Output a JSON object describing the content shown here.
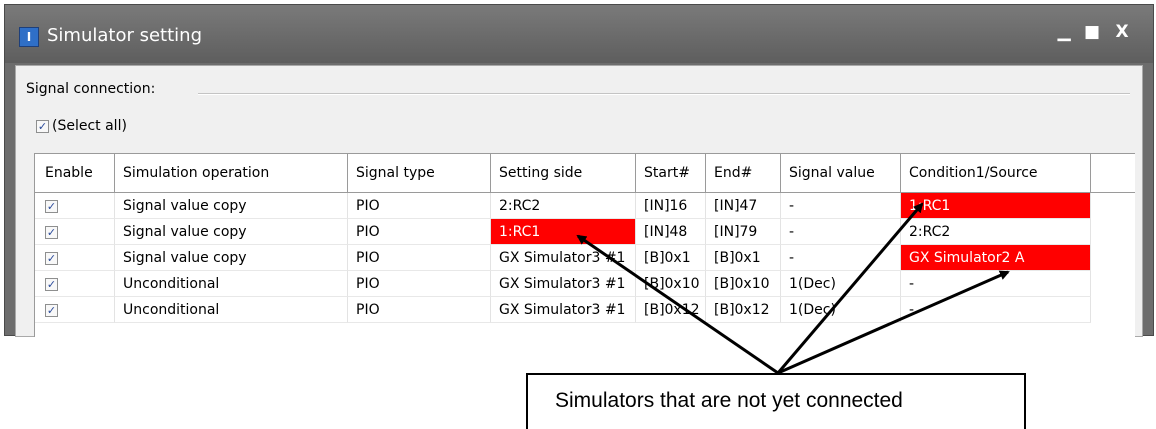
{
  "window": {
    "title": "Simulator setting",
    "icon": "app-icon",
    "controls": {
      "minimize": "_",
      "maximize": "□",
      "close": "X"
    }
  },
  "group": {
    "label": "Signal connection:"
  },
  "select_all": {
    "label": "(Select all)",
    "checked": true
  },
  "table": {
    "headers": {
      "enable": "Enable",
      "operation": "Simulation operation",
      "signal_type": "Signal type",
      "setting_side": "Setting side",
      "start": "Start#",
      "end": "End#",
      "signal_value": "Signal value",
      "condition": "Condition1/Source"
    },
    "rows": [
      {
        "enabled": true,
        "operation": "Signal value copy",
        "signal_type": "PIO",
        "setting_side": "2:RC2",
        "start": "[IN]16",
        "end": "[IN]47",
        "signal_value": "-",
        "condition": "1:RC1",
        "side_highlight": false,
        "cond_highlight": true
      },
      {
        "enabled": true,
        "operation": "Signal value copy",
        "signal_type": "PIO",
        "setting_side": "1:RC1",
        "start": "[IN]48",
        "end": "[IN]79",
        "signal_value": "-",
        "condition": "2:RC2",
        "side_highlight": true,
        "cond_highlight": false
      },
      {
        "enabled": true,
        "operation": "Signal value copy",
        "signal_type": "PIO",
        "setting_side": "GX Simulator3 #1",
        "start": "[B]0x1",
        "end": "[B]0x1",
        "signal_value": "-",
        "condition": "GX Simulator2 A",
        "side_highlight": false,
        "cond_highlight": true
      },
      {
        "enabled": true,
        "operation": "Unconditional",
        "signal_type": "PIO",
        "setting_side": "GX Simulator3 #1",
        "start": "[B]0x10",
        "end": "[B]0x10",
        "signal_value": "1(Dec)",
        "condition": "-",
        "side_highlight": false,
        "cond_highlight": false
      },
      {
        "enabled": true,
        "operation": "Unconditional",
        "signal_type": "PIO",
        "setting_side": "GX Simulator3 #1",
        "start": "[B]0x12",
        "end": "[B]0x12",
        "signal_value": "1(Dec)",
        "condition": "-",
        "side_highlight": false,
        "cond_highlight": false
      }
    ]
  },
  "callout": {
    "text": "Simulators that are not yet connected"
  },
  "colors": {
    "highlight": "#ff0000",
    "titlebar": "#6d6d6d",
    "checkmark": "#2a4a9a"
  }
}
